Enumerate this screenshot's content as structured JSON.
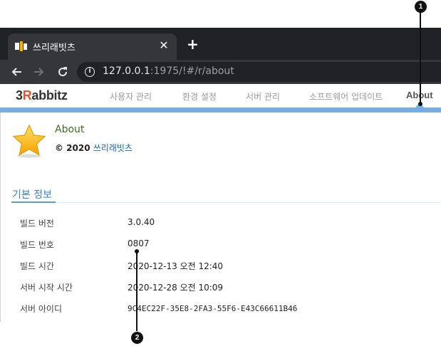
{
  "browser": {
    "tab_title": "쓰리래빗츠",
    "tab_close": "✕",
    "new_tab": "+",
    "url_host": "127.0.0.1",
    "url_rest": ":1975/!#/r/about"
  },
  "app": {
    "logo_prefix": "3",
    "logo_r": "R",
    "logo_suffix": "abbitz",
    "menu": [
      {
        "label": "사용자 관리"
      },
      {
        "label": "환경 설정"
      },
      {
        "label": "서버 관리"
      },
      {
        "label": "소프트웨어 업데이트"
      },
      {
        "label": "About",
        "active": true
      }
    ],
    "accent_color": "#79aee4"
  },
  "about": {
    "title": "About",
    "copyright_prefix": "© 2020",
    "company": "쓰리래빗츠"
  },
  "basic_info": {
    "section_title": "기본 정보",
    "rows": [
      {
        "label": "빌드 버전",
        "value": "3.0.40"
      },
      {
        "label": "빌드 번호",
        "value": "0807"
      },
      {
        "label": "빌드 시간",
        "value": "2020-12-13 오전 12:40"
      },
      {
        "label": "서버 시작 시간",
        "value": "2020-12-28 오전 10:09"
      },
      {
        "label": "서버 아이디",
        "value": "9C4EC22F-35E8-2FA3-55F6-E43C66611B46"
      }
    ]
  },
  "callouts": [
    {
      "number": "1"
    },
    {
      "number": "2"
    }
  ]
}
